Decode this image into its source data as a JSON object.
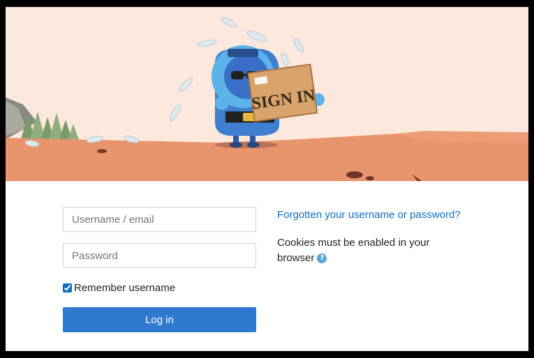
{
  "banner": {
    "box_label": "SIGN IN"
  },
  "login_form": {
    "username_placeholder": "Username / email",
    "username_value": "",
    "password_placeholder": "Password",
    "password_value": "",
    "remember_label": "Remember username",
    "remember_checked": true,
    "login_button_label": "Log in"
  },
  "info": {
    "forgot_link": "Forgotten your username or password?",
    "cookies_text": "Cookies must be enabled in your browser",
    "help_icon": "question-circle-icon"
  },
  "colors": {
    "sky": "#fce8dc",
    "ground": "#e8956d",
    "button": "#3079d1",
    "link": "#0f6cbf",
    "help_icon": "#5aa6d8"
  }
}
